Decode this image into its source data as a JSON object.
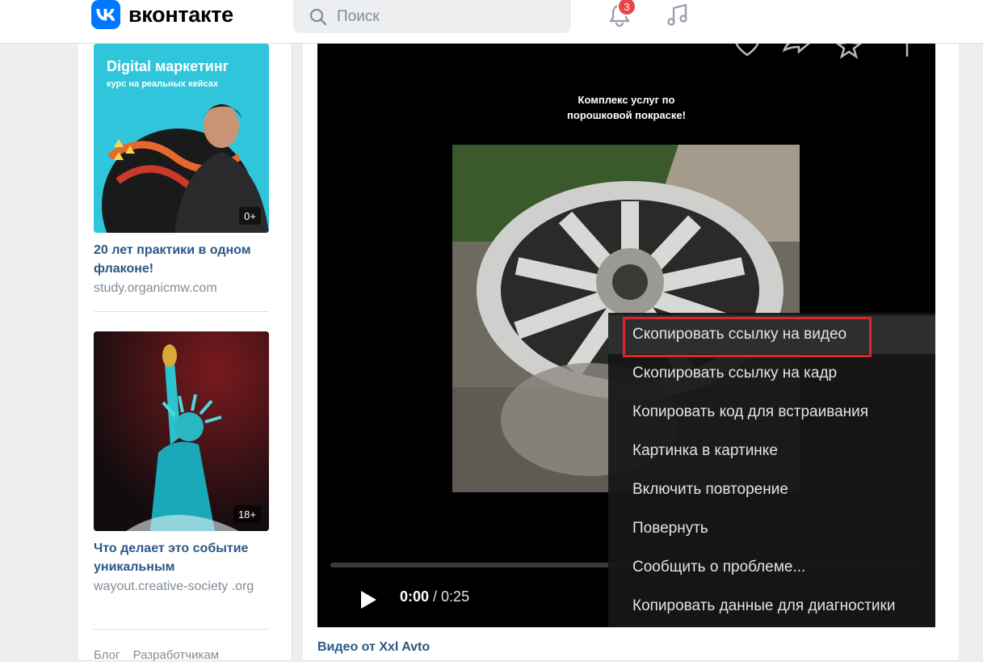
{
  "header": {
    "logo_text": "вконтакте",
    "search_placeholder": "Поиск",
    "notifications_count": "3"
  },
  "ads": [
    {
      "image_title": "Digital маркетинг",
      "image_subtitle": "курс на реальных кейсах",
      "age": "0+",
      "title": "20 лет практики в одном флаконе!",
      "url": "study.organicmw.com"
    },
    {
      "age": "18+",
      "title": "Что делает это событие уникальным",
      "url": "wayout.creative-society .org"
    }
  ],
  "footer": {
    "links": [
      "Блог",
      "Разработчикам"
    ]
  },
  "video": {
    "caption_line1": "Комплекс услуг по",
    "caption_line2": "порошковой покраске!",
    "current_time": "0:00",
    "separator": " / ",
    "duration": "0:25",
    "title": "Видео от Xxl Avto"
  },
  "context_menu": {
    "items": [
      "Скопировать ссылку на видео",
      "Скопировать ссылку на кадр",
      "Копировать код для встраивания",
      "Картинка в картинке",
      "Включить повторение",
      "Повернуть",
      "Сообщить о проблеме...",
      "Копировать данные для диагностики"
    ],
    "highlighted_index": 0
  },
  "colors": {
    "accent": "#0077ff",
    "link": "#2a5885",
    "badge": "#e64646",
    "highlight": "#e1232d"
  }
}
